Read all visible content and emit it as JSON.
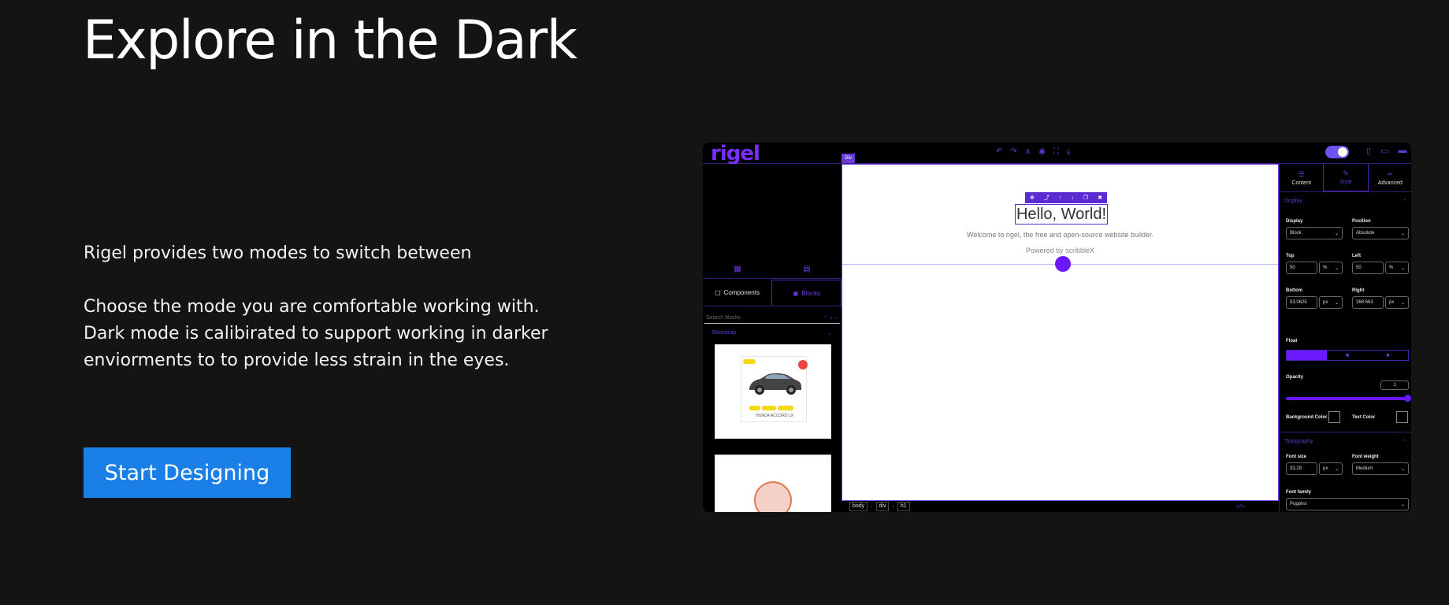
{
  "hero": {
    "title": "Explore in the Dark",
    "intro_line1": "Rigel provides two modes to switch between",
    "intro_line2": "Choose the mode you are comfortable working with.",
    "intro_line3": "Dark mode is calibirated to support working in darker enviorments to to provide less strain in the eyes.",
    "cta_label": "Start Designing"
  },
  "app": {
    "logo": "rigel",
    "theme": "dark",
    "accent_color": "#6b18ff",
    "toolbar_icons": [
      "undo-icon",
      "redo-icon",
      "code-icon",
      "eye-icon",
      "fullscreen-icon",
      "download-icon"
    ],
    "device_icons": [
      "mobile-icon",
      "tablet-icon",
      "desktop-icon"
    ],
    "left_tabs": [
      "Components",
      "Blocks"
    ],
    "search_placeholder": "Search blocks",
    "block_group": "Bootstrap",
    "card_car_name": "HONDA ACCORD LX",
    "canvas_tag": "Div",
    "canvas_heading": "Hello, World!",
    "canvas_welcome": "Welcome to rigel, the free and open-source website builder.",
    "canvas_powered": "Powered by scribbleX",
    "breadcrumbs": [
      "body",
      "div",
      "h1"
    ],
    "breadcrumb_code": "</>",
    "right_tabs": [
      "Content",
      "Style",
      "Advanced"
    ],
    "sections": {
      "display": "Display",
      "typography": "Typography"
    },
    "fields": {
      "display_label": "Display",
      "display_value": "Block",
      "position_label": "Position",
      "position_value": "Absolute",
      "top_label": "Top",
      "top_value": "50",
      "top_unit": "%",
      "left_label": "Left",
      "left_value": "50",
      "left_unit": "%",
      "bottom_label": "Bottom",
      "bottom_value": "53.0625",
      "bottom_unit": "px",
      "right_label": "Right",
      "right_value": "268.663",
      "right_unit": "px",
      "float_label": "Float",
      "opacity_label": "Opacity",
      "opacity_value": "1",
      "bg_color_label": "Background Color",
      "text_color_label": "Text Color",
      "font_size_label": "Font size",
      "font_size_value": "33.29",
      "font_size_unit": "px",
      "font_weight_label": "Font weight",
      "font_weight_value": "Medium",
      "font_family_label": "Font family",
      "font_family_value": "Poppins"
    }
  }
}
